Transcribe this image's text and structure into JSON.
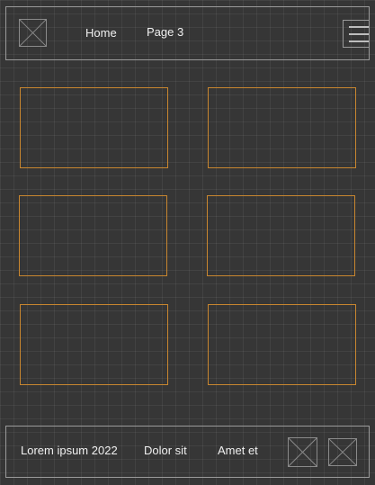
{
  "header": {
    "logo_icon": "image-placeholder-icon",
    "nav": [
      {
        "label": "Home"
      },
      {
        "label": "Page 3"
      }
    ],
    "menu_icon": "hamburger-menu-icon"
  },
  "cards": [
    {
      "id": 1
    },
    {
      "id": 2
    },
    {
      "id": 3
    },
    {
      "id": 4
    },
    {
      "id": 5
    },
    {
      "id": 6
    }
  ],
  "footer": {
    "items": [
      {
        "label": "Lorem ipsum 2022"
      },
      {
        "label": "Dolor sit"
      },
      {
        "label": "Amet et"
      }
    ],
    "icons": [
      "image-placeholder-icon",
      "image-placeholder-icon"
    ]
  },
  "colors": {
    "accent": "#c8862f",
    "background": "#363636",
    "outline": "#9a9a9a"
  }
}
